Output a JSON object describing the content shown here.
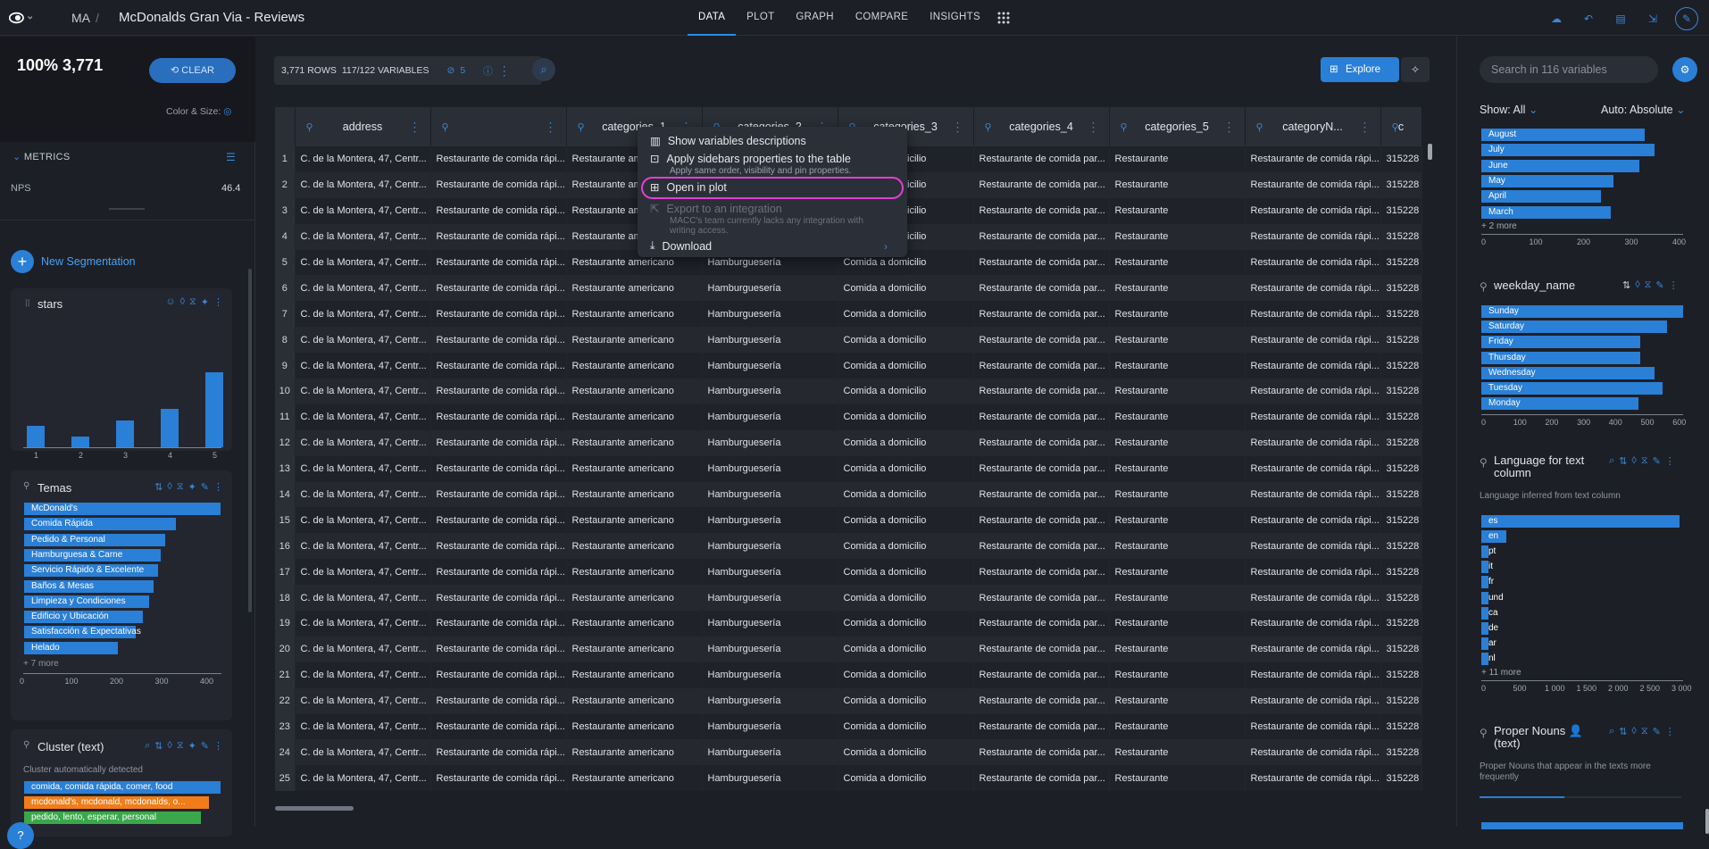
{
  "header": {
    "crumb": "MA",
    "sep": "/",
    "title": "McDonalds Gran Via - Reviews",
    "tabs": [
      "DATA",
      "PLOT",
      "GRAPH",
      "COMPARE",
      "INSIGHTS"
    ]
  },
  "summary": {
    "pct": "100%  3,771",
    "clear": "CLEAR",
    "color_size": "Color & Size:"
  },
  "metrics": {
    "title": "METRICS",
    "nps_label": "NPS",
    "nps_value": "46.4"
  },
  "new_segmentation": "New Segmentation",
  "stars": {
    "title": "stars",
    "labels": [
      "1",
      "2",
      "3",
      "4",
      "5"
    ],
    "values": [
      0.28,
      0.14,
      0.36,
      0.51,
      1.0
    ]
  },
  "temas": {
    "title": "Temas",
    "items": [
      {
        "label": "McDonald's",
        "value": 440
      },
      {
        "label": "Comida Rápida",
        "value": 340
      },
      {
        "label": "Pedido & Personal",
        "value": 315
      },
      {
        "label": "Hamburguesa & Carne",
        "value": 305
      },
      {
        "label": "Servicio Rápido & Excelente",
        "value": 300
      },
      {
        "label": "Baños & Mesas",
        "value": 290
      },
      {
        "label": "Limpieza y Condiciones",
        "value": 280
      },
      {
        "label": "Edificio y Ubicación",
        "value": 265
      },
      {
        "label": "Satisfacción & Expectativas",
        "value": 250
      },
      {
        "label": "Helado",
        "value": 210
      }
    ],
    "more": "+ 7 more",
    "ticks": [
      "0",
      "100",
      "200",
      "300",
      "400"
    ]
  },
  "cluster": {
    "title": "Cluster (text)",
    "sub": "Cluster automatically detected",
    "items": [
      {
        "label": "comida, comida rápida, comer, food",
        "color": "#2a7fd6",
        "value": 1.0
      },
      {
        "label": "mcdonald's, mcdonald, mcdonalds, o...",
        "color": "#f07d1a",
        "value": 0.94
      },
      {
        "label": "pedido, lento, esperar, personal",
        "color": "#3aa84a",
        "value": 0.9
      }
    ]
  },
  "toolbar": {
    "rows": "3,771 ROWS",
    "vars": "117/122 VARIABLES",
    "hidden": "5",
    "explore": "Explore"
  },
  "table": {
    "columns": [
      "address",
      "",
      "categories_1",
      "categories_2",
      "categories_3",
      "categories_4",
      "categories_5",
      "categoryN...",
      "c"
    ],
    "row_values": [
      "C. de la Montera, 47, Centr...",
      "Restaurante de comida rápi...",
      "Restaurante americano",
      "Hamburguesería",
      "Comida a domicilio",
      "Restaurante de comida par...",
      "Restaurante",
      "Restaurante de comida rápi...",
      "315228"
    ],
    "row_count": 25
  },
  "dropdown": {
    "show_desc": "Show variables descriptions",
    "apply": "Apply sidebars properties to the table",
    "apply_sub": "Apply same order, visibility and pin properties.",
    "open_plot": "Open in plot",
    "export": "Export to an integration",
    "export_sub1": "MACC's team currently lacks any integration with",
    "export_sub2": "writing access.",
    "download": "Download"
  },
  "right": {
    "search_placeholder": "Search in 116 variables",
    "show_label": "Show:",
    "show_value": "All",
    "auto_label": "Auto: Absolute",
    "months": {
      "items": [
        {
          "label": "August",
          "value": 340
        },
        {
          "label": "July",
          "value": 360
        },
        {
          "label": "June",
          "value": 330
        },
        {
          "label": "May",
          "value": 275
        },
        {
          "label": "April",
          "value": 250
        },
        {
          "label": "March",
          "value": 270
        }
      ],
      "more": "+ 2 more",
      "ticks": [
        "0",
        "100",
        "200",
        "300",
        "400"
      ]
    },
    "weekday": {
      "title": "weekday_name",
      "items": [
        {
          "label": "Sunday",
          "value": 630
        },
        {
          "label": "Saturday",
          "value": 580
        },
        {
          "label": "Friday",
          "value": 495
        },
        {
          "label": "Thursday",
          "value": 495
        },
        {
          "label": "Wednesday",
          "value": 540
        },
        {
          "label": "Tuesday",
          "value": 565
        },
        {
          "label": "Monday",
          "value": 490
        }
      ],
      "ticks": [
        "0",
        "100",
        "200",
        "300",
        "400",
        "500",
        "600"
      ]
    },
    "language": {
      "title": "Language for text column",
      "sub": "Language inferred from text column",
      "items": [
        {
          "label": "es",
          "value": 2800
        },
        {
          "label": "en",
          "value": 350
        },
        {
          "label": "pt",
          "value": 90
        },
        {
          "label": "it",
          "value": 60
        },
        {
          "label": "fr",
          "value": 50
        },
        {
          "label": "und",
          "value": 40
        },
        {
          "label": "ca",
          "value": 20
        },
        {
          "label": "de",
          "value": 15
        },
        {
          "label": "ar",
          "value": 10
        },
        {
          "label": "nl",
          "value": 8
        }
      ],
      "more": "+ 11 more",
      "ticks": [
        "0",
        "500",
        "1 000",
        "1 500",
        "2 000",
        "2 500",
        "3 000"
      ]
    },
    "proper": {
      "title": "Proper Nouns 👤 (text)",
      "sub": "Proper Nouns that appear in the texts more frequently"
    }
  }
}
